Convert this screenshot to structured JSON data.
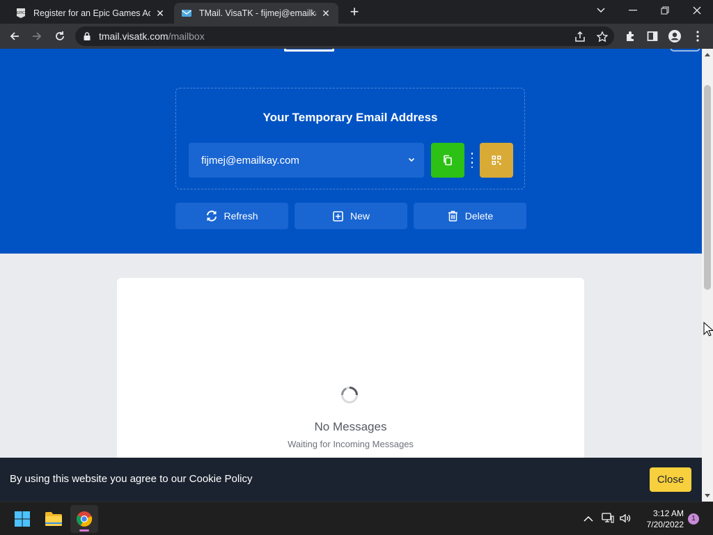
{
  "browser": {
    "tabs": [
      {
        "title": "Register for an Epic Games Accou",
        "favicon": "epic-games-icon",
        "active": false
      },
      {
        "title": "TMail. VisaTK - fijmej@emailkay.c",
        "favicon": "mail-icon",
        "active": true
      }
    ],
    "url": {
      "host": "tmail.visatk.com",
      "path": "/mailbox"
    }
  },
  "page": {
    "panel_title": "Your Temporary Email Address",
    "email_address": "fijmej@emailkay.com",
    "actions": {
      "refresh": "Refresh",
      "new": "New",
      "delete": "Delete"
    },
    "inbox": {
      "empty_title": "No Messages",
      "empty_subtitle": "Waiting for Incoming Messages"
    },
    "cookie": {
      "text": "By using this website you agree to our Cookie Policy",
      "close_label": "Close"
    }
  },
  "colors": {
    "hero_blue": "#0153c4",
    "button_blue": "#1965d2",
    "copy_green": "#2dc015",
    "qr_gold": "#d9aa35",
    "cookie_yellow": "#f8cf3d"
  },
  "taskbar": {
    "time": "3:12 AM",
    "date": "7/20/2022",
    "notification_count": "1"
  }
}
